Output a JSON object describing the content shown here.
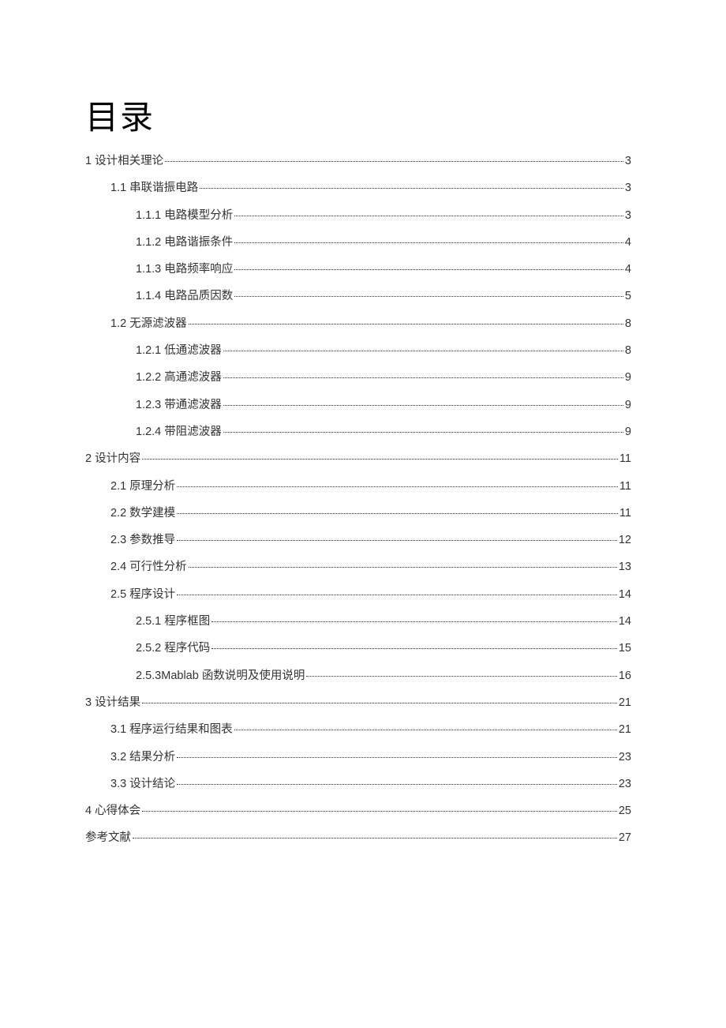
{
  "title": "目录",
  "toc": [
    {
      "level": 1,
      "label": "1 设计相关理论",
      "page": "3"
    },
    {
      "level": 2,
      "label": "1.1 串联谐振电路",
      "page": "3"
    },
    {
      "level": 3,
      "label": "1.1.1 电路模型分析",
      "page": "3"
    },
    {
      "level": 3,
      "label": "1.1.2 电路谐振条件",
      "page": "4"
    },
    {
      "level": 3,
      "label": "1.1.3 电路频率响应",
      "page": "4"
    },
    {
      "level": 3,
      "label": "1.1.4 电路品质因数",
      "page": "5"
    },
    {
      "level": 2,
      "label": "1.2 无源滤波器",
      "page": "8"
    },
    {
      "level": 3,
      "label": "1.2.1 低通滤波器",
      "page": "8"
    },
    {
      "level": 3,
      "label": "1.2.2 高通滤波器",
      "page": "9"
    },
    {
      "level": 3,
      "label": "1.2.3 带通滤波器",
      "page": "9"
    },
    {
      "level": 3,
      "label": "1.2.4 带阻滤波器",
      "page": "9"
    },
    {
      "level": 1,
      "label": "2 设计内容",
      "page": "11"
    },
    {
      "level": 2,
      "label": "2.1 原理分析",
      "page": "11"
    },
    {
      "level": 2,
      "label": "2.2 数学建模",
      "page": "11"
    },
    {
      "level": 2,
      "label": "2.3 参数推导",
      "page": "12"
    },
    {
      "level": 2,
      "label": "2.4 可行性分析",
      "page": "13"
    },
    {
      "level": 2,
      "label": "2.5 程序设计",
      "page": "14"
    },
    {
      "level": 3,
      "label": "2.5.1 程序框图",
      "page": "14"
    },
    {
      "level": 3,
      "label": "2.5.2 程序代码",
      "page": "15"
    },
    {
      "level": 3,
      "label": "2.5.3Mablab 函数说明及使用说明",
      "page": "16"
    },
    {
      "level": 1,
      "label": "3 设计结果",
      "page": "21"
    },
    {
      "level": 2,
      "label": "3.1 程序运行结果和图表",
      "page": "21"
    },
    {
      "level": 2,
      "label": "3.2 结果分析",
      "page": "23"
    },
    {
      "level": 2,
      "label": "3.3 设计结论",
      "page": "23"
    },
    {
      "level": 1,
      "label": "4 心得体会",
      "page": "25"
    },
    {
      "level": 1,
      "label": "参考文献",
      "page": "27"
    }
  ]
}
